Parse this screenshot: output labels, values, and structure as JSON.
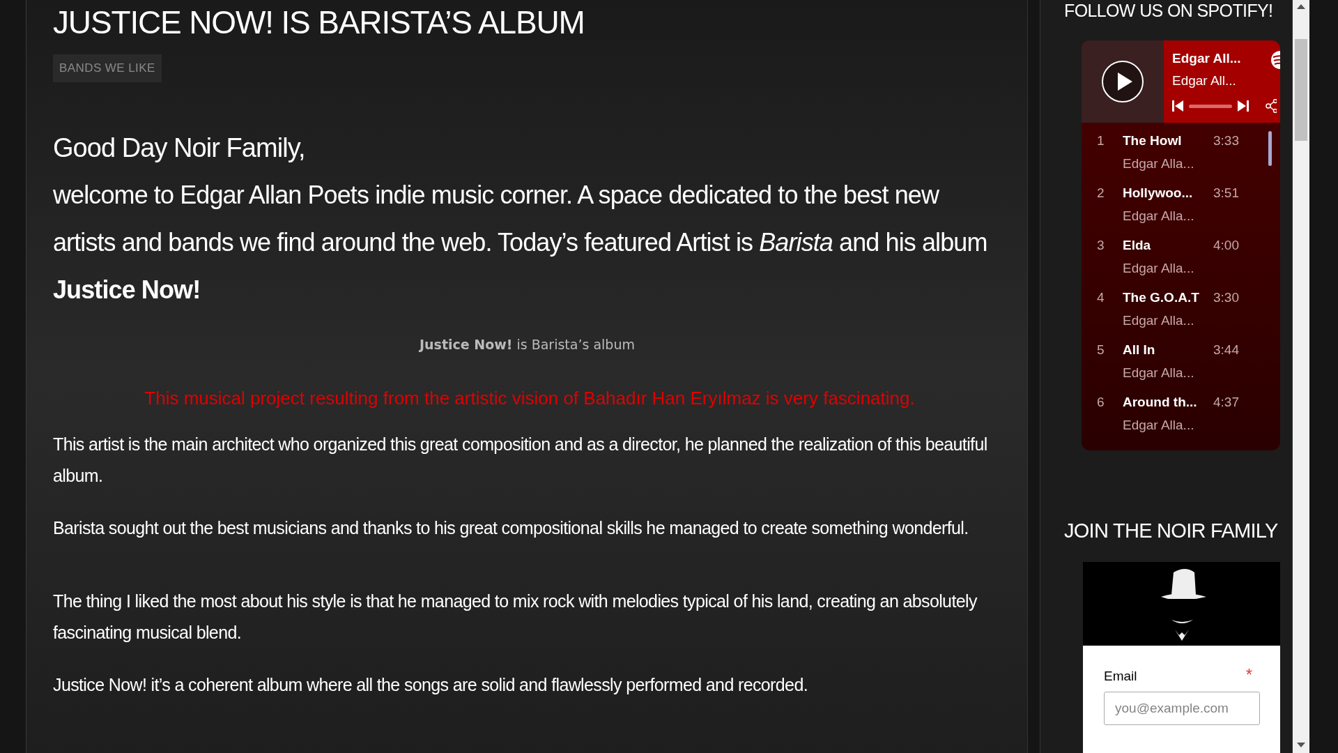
{
  "post": {
    "title": "JUSTICE NOW! IS BARISTA’S ALBUM",
    "category": "BANDS WE LIKE",
    "greeting": "Good Day Noir Family,",
    "intro": "welcome to Edgar Allan Poets indie music corner. A space dedicated to the best new artists and bands we find around the web. Today’s featured Artist is *Barista* and his album **Justice Now!**",
    "caption": "**Justice Now!** is Barista’s album",
    "highlight": "This musical project resulting from the artistic vision of Bahadır Han Eryılmaz is very fascinating.",
    "paragraphs": [
      "This artist is the main architect who organized this great composition and as a director, he planned the realization of this beautiful album.",
      "Barista sought out the best musicians and thanks to his great compositional skills he managed to create something wonderful.",
      "The thing I liked the most about his style is that he managed to mix rock with melodies typical of his land, creating an absolutely fascinating musical blend.",
      "Justice Now! it’s a coherent album where all the songs are solid and flawlessly performed and recorded."
    ]
  },
  "sidebar": {
    "spotify_heading": "FOLLOW US ON SPOTIFY!",
    "player": {
      "title": "Edgar All...",
      "artist": "Edgar All...",
      "level": 0,
      "tracks": [
        {
          "number": "1",
          "title": "The Howl",
          "artist": "Edgar Alla...",
          "duration": "3:33"
        },
        {
          "number": "2",
          "title": "Hollywoo...",
          "artist": "Edgar Alla...",
          "duration": "3:51"
        },
        {
          "number": "3",
          "title": "Elda",
          "artist": "Edgar Alla...",
          "duration": "4:00"
        },
        {
          "number": "4",
          "title": "The G.O.A.T",
          "artist": "Edgar Alla...",
          "duration": "3:30"
        },
        {
          "number": "5",
          "title": "All In",
          "artist": "Edgar Alla...",
          "duration": "3:44"
        },
        {
          "number": "6",
          "title": "Around th...",
          "artist": "Edgar Alla...",
          "duration": "4:37"
        }
      ]
    },
    "join_heading": "JOIN THE NOIR FAMILY",
    "signup": {
      "label": "Email",
      "required_mark": "*",
      "placeholder": "you@example.com"
    }
  }
}
